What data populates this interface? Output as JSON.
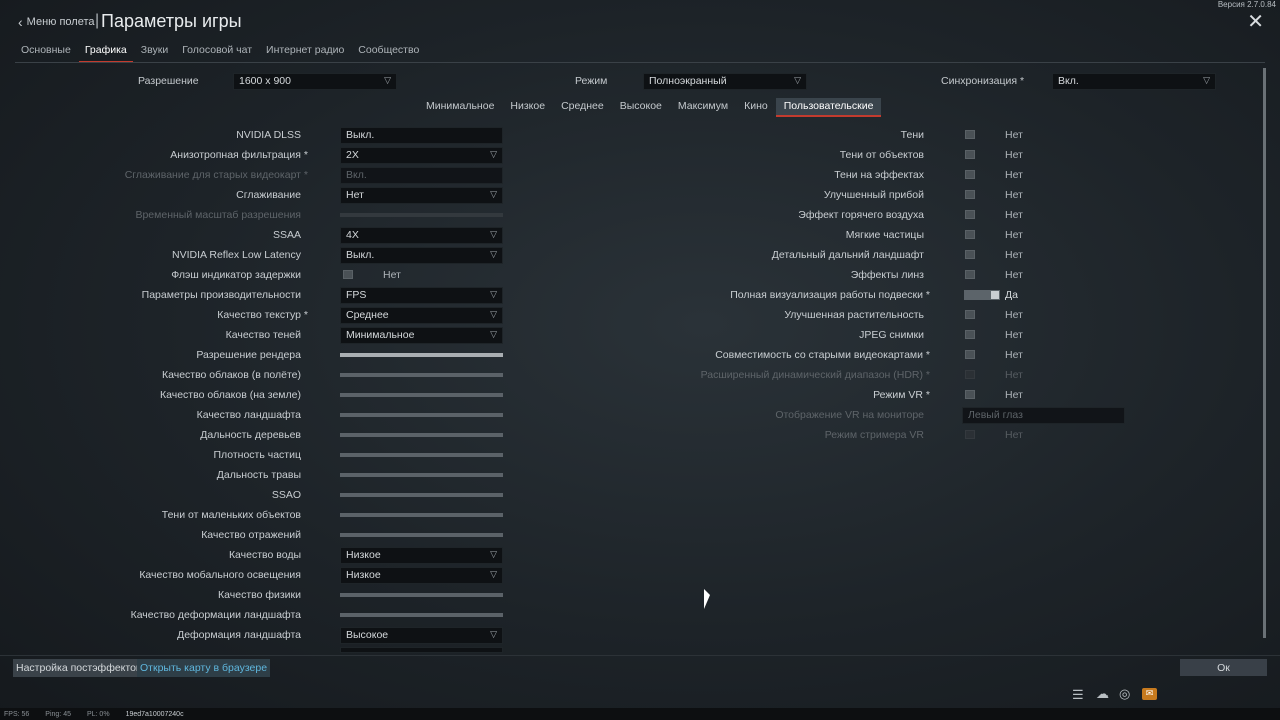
{
  "window": {
    "version": "Версия 2.7.0.84",
    "back_label": "Меню полета",
    "title": "Параметры игры"
  },
  "tabs": [
    "Основные",
    "Графика",
    "Звуки",
    "Голосовой чат",
    "Интернет радио",
    "Сообщество"
  ],
  "top_settings": {
    "resolution_label": "Разрешение",
    "resolution_value": "1600 x 900",
    "mode_label": "Режим",
    "mode_value": "Полноэкранный",
    "sync_label": "Синхронизация *",
    "sync_value": "Вкл."
  },
  "presets": [
    "Минимальное",
    "Низкое",
    "Среднее",
    "Высокое",
    "Максимум",
    "Кино",
    "Пользовательские"
  ],
  "left_settings": [
    {
      "label": "NVIDIA DLSS",
      "value": "Выкл."
    },
    {
      "label": "Анизотропная фильтрация *",
      "value": "2X"
    },
    {
      "label": "Сглаживание для старых видеокарт *",
      "value": "Вкл."
    },
    {
      "label": "Сглаживание",
      "value": "Нет"
    },
    {
      "label": "Временный масштаб разрешения"
    },
    {
      "label": "SSAA",
      "value": "4X"
    },
    {
      "label": "NVIDIA Reflex Low Latency",
      "value": "Выкл."
    },
    {
      "label": "Флэш индикатор задержки",
      "value": "Нет"
    },
    {
      "label": "Параметры производительности",
      "value": "FPS"
    },
    {
      "label": "Качество текстур *",
      "value": "Среднее"
    },
    {
      "label": "Качество теней",
      "value": "Минимальное"
    },
    {
      "label": "Разрешение рендера"
    },
    {
      "label": "Качество облаков (в полёте)"
    },
    {
      "label": "Качество облаков (на земле)"
    },
    {
      "label": "Качество ландшафта"
    },
    {
      "label": "Дальность деревьев"
    },
    {
      "label": "Плотность частиц"
    },
    {
      "label": "Дальность травы"
    },
    {
      "label": "SSAO"
    },
    {
      "label": "Тени от маленьких объектов"
    },
    {
      "label": "Качество отражений"
    },
    {
      "label": "Качество воды",
      "value": "Низкое"
    },
    {
      "label": "Качество мобального освещения",
      "value": "Низкое"
    },
    {
      "label": "Качество физики"
    },
    {
      "label": "Качество деформации ландшафта"
    },
    {
      "label": "Деформация ландшафта",
      "value": "Высокое"
    }
  ],
  "right_settings": [
    {
      "label": "Тени",
      "value": "Нет"
    },
    {
      "label": "Тени от объектов",
      "value": "Нет"
    },
    {
      "label": "Тени на эффектах",
      "value": "Нет"
    },
    {
      "label": "Улучшенный прибой",
      "value": "Нет"
    },
    {
      "label": "Эффект горячего воздуха",
      "value": "Нет"
    },
    {
      "label": "Мягкие частицы",
      "value": "Нет"
    },
    {
      "label": "Детальный дальний ландшафт",
      "value": "Нет"
    },
    {
      "label": "Эффекты линз",
      "value": "Нет"
    },
    {
      "label": "Полная визуализация работы подвески *",
      "value": "Да"
    },
    {
      "label": "Улучшенная растительность",
      "value": "Нет"
    },
    {
      "label": "JPEG снимки",
      "value": "Нет"
    },
    {
      "label": "Совместимость со старыми видеокартами *",
      "value": "Нет"
    },
    {
      "label": "Расширенный динамический диапазон (HDR) *",
      "value": "Нет"
    },
    {
      "label": "Режим VR *",
      "value": "Нет"
    },
    {
      "label": "Отображение VR на мониторе",
      "value": "Левый глаз"
    },
    {
      "label": "Режим стримера VR",
      "value": "Нет"
    }
  ],
  "bottom": {
    "postfx_button": "Настройка постэффектов",
    "map_button": "Открыть карту в браузере",
    "ok_button": "Ок",
    "icons": [
      "list-icon",
      "squad-icon",
      "chat-icon",
      "mail-icon"
    ]
  },
  "statusbar": {
    "fps": "FPS: 56",
    "ping": "Ping: 45",
    "pl": "PL: 0%",
    "id": "19ed7a10007240c"
  },
  "colors": {
    "accent": "#c33b2e",
    "link": "#5fb7de",
    "mail": "#c77a1e"
  }
}
